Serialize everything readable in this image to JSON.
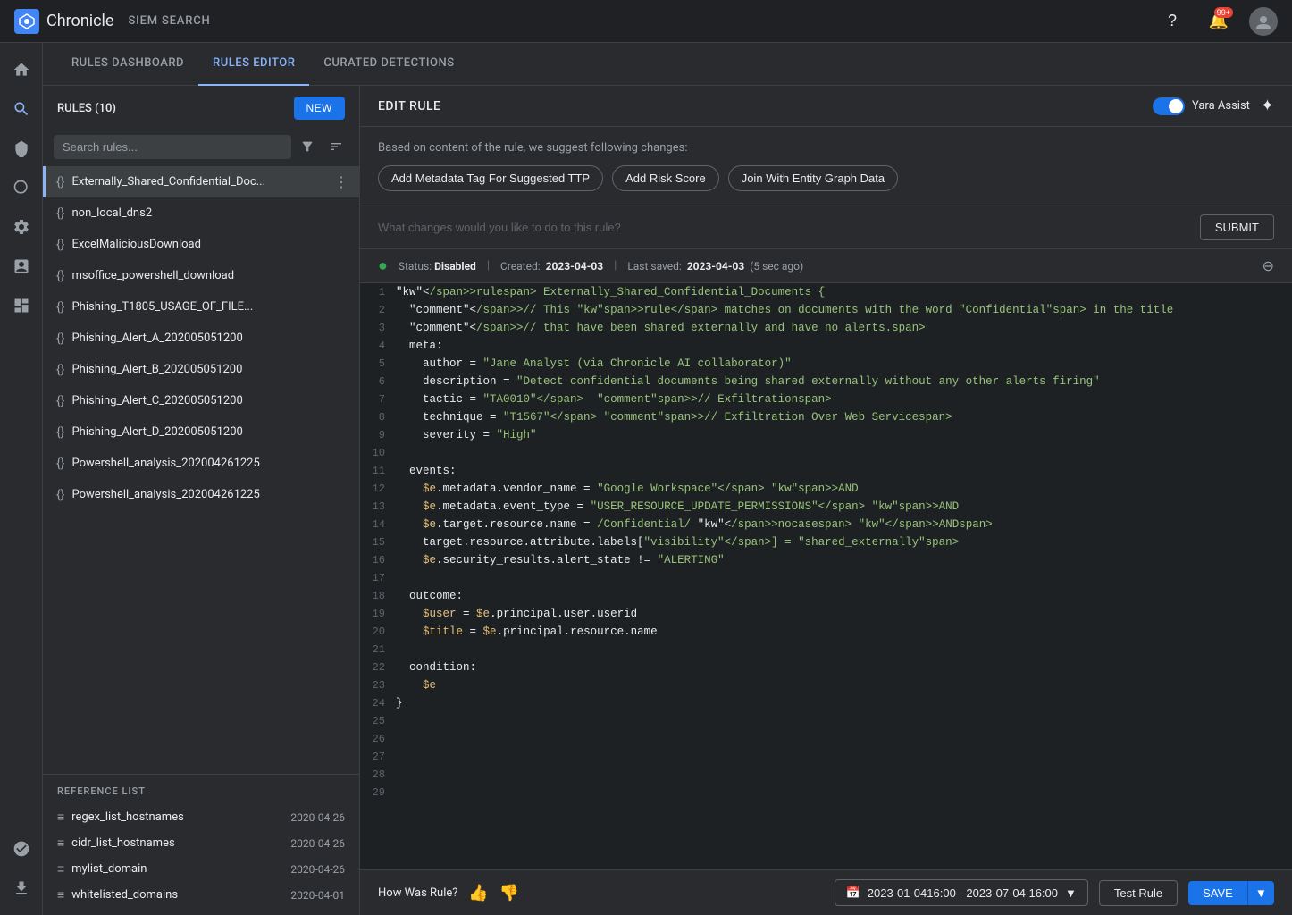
{
  "app": {
    "name": "Chronicle",
    "nav_title": "SIEM SEARCH"
  },
  "top_nav": {
    "help_label": "?",
    "notification_count": "99+",
    "avatar_label": "U"
  },
  "tabs": [
    {
      "id": "rules-dashboard",
      "label": "RULES DASHBOARD",
      "active": false
    },
    {
      "id": "rules-editor",
      "label": "RULES EDITOR",
      "active": true
    },
    {
      "id": "curated-detections",
      "label": "CURATED DETECTIONS",
      "active": false
    }
  ],
  "sidebar": {
    "title": "RULES (10)",
    "new_btn_label": "NEW",
    "search_placeholder": "Search rules...",
    "rules": [
      {
        "id": 1,
        "name": "Externally_Shared_Confidential_Doc...",
        "active": true
      },
      {
        "id": 2,
        "name": "non_local_dns2",
        "active": false
      },
      {
        "id": 3,
        "name": "ExcelMaliciousDownload",
        "active": false
      },
      {
        "id": 4,
        "name": "msoffice_powershell_download",
        "active": false
      },
      {
        "id": 5,
        "name": "Phishing_T1805_USAGE_OF_FILE...",
        "active": false
      },
      {
        "id": 6,
        "name": "Phishing_Alert_A_202005051200",
        "active": false
      },
      {
        "id": 7,
        "name": "Phishing_Alert_B_202005051200",
        "active": false
      },
      {
        "id": 8,
        "name": "Phishing_Alert_C_202005051200",
        "active": false
      },
      {
        "id": 9,
        "name": "Phishing_Alert_D_202005051200",
        "active": false
      },
      {
        "id": 10,
        "name": "Powershell_analysis_202004261225",
        "active": false
      },
      {
        "id": 11,
        "name": "Powershell_analysis_202004261225",
        "active": false
      }
    ],
    "reference_list_title": "REFERENCE LIST",
    "reference_items": [
      {
        "id": 1,
        "name": "regex_list_hostnames",
        "date": "2020-04-26"
      },
      {
        "id": 2,
        "name": "cidr_list_hostnames",
        "date": "2020-04-26"
      },
      {
        "id": 3,
        "name": "mylist_domain",
        "date": "2020-04-26"
      },
      {
        "id": 4,
        "name": "whitelisted_domains",
        "date": "2020-04-01"
      }
    ]
  },
  "editor": {
    "header_title": "EDIT RULE",
    "yara_label": "Yara Assist",
    "suggestions_text": "Based on content of the rule, we suggest following changes:",
    "suggestion_btns": [
      {
        "id": "add-metadata",
        "label": "Add Metadata Tag For  Suggested TTP"
      },
      {
        "id": "add-risk",
        "label": "Add Risk Score"
      },
      {
        "id": "join-entity",
        "label": "Join With Entity Graph Data"
      }
    ],
    "query_placeholder": "What changes would you like to do to this rule?",
    "submit_label": "SUBMIT",
    "status": {
      "state": "Disabled",
      "created_label": "Created:",
      "created_date": "2023-04-03",
      "saved_label": "Last saved:",
      "saved_date": "2023-04-03",
      "saved_ago": "(5 sec ago)"
    },
    "code_lines": [
      {
        "num": 1,
        "content": "rule Externally_Shared_Confidential_Documents {"
      },
      {
        "num": 2,
        "content": "  // This rule matches on documents with the word \"Confidential\" in the title"
      },
      {
        "num": 3,
        "content": "  // that have been shared externally and have no alerts."
      },
      {
        "num": 4,
        "content": "  meta:"
      },
      {
        "num": 5,
        "content": "    author = \"Jane Analyst (via Chronicle AI collaborator)\""
      },
      {
        "num": 6,
        "content": "    description = \"Detect confidential documents being shared externally without any other alerts firing\""
      },
      {
        "num": 7,
        "content": "    tactic = \"TA0010\"  // Exfiltration"
      },
      {
        "num": 8,
        "content": "    technique = \"T1567\" // Exfiltration Over Web Service"
      },
      {
        "num": 9,
        "content": "    severity = \"High\""
      },
      {
        "num": 10,
        "content": ""
      },
      {
        "num": 11,
        "content": "  events:"
      },
      {
        "num": 12,
        "content": "    $e.metadata.vendor_name = \"Google Workspace\" AND"
      },
      {
        "num": 13,
        "content": "    $e.metadata.event_type = \"USER_RESOURCE_UPDATE_PERMISSIONS\" AND"
      },
      {
        "num": 14,
        "content": "    $e.target.resource.name = /Confidential/ nocase AND"
      },
      {
        "num": 15,
        "content": "    target.resource.attribute.labels[\"visibility\"] = \"shared_externally\""
      },
      {
        "num": 16,
        "content": "    $e.security_results.alert_state != \"ALERTING\""
      },
      {
        "num": 17,
        "content": ""
      },
      {
        "num": 18,
        "content": "  outcome:"
      },
      {
        "num": 19,
        "content": "    $user = $e.principal.user.userid"
      },
      {
        "num": 20,
        "content": "    $title = $e.principal.resource.name"
      },
      {
        "num": 21,
        "content": ""
      },
      {
        "num": 22,
        "content": "  condition:"
      },
      {
        "num": 23,
        "content": "    $e"
      },
      {
        "num": 24,
        "content": "}"
      },
      {
        "num": 25,
        "content": ""
      },
      {
        "num": 26,
        "content": ""
      },
      {
        "num": 27,
        "content": ""
      },
      {
        "num": 28,
        "content": ""
      },
      {
        "num": 29,
        "content": ""
      }
    ]
  },
  "bottom_bar": {
    "how_was_rule": "How Was Rule?",
    "date_range": "2023-01-0416:00 - 2023-07-04 16:00",
    "test_rule_label": "Test Rule",
    "save_label": "SAVE"
  }
}
